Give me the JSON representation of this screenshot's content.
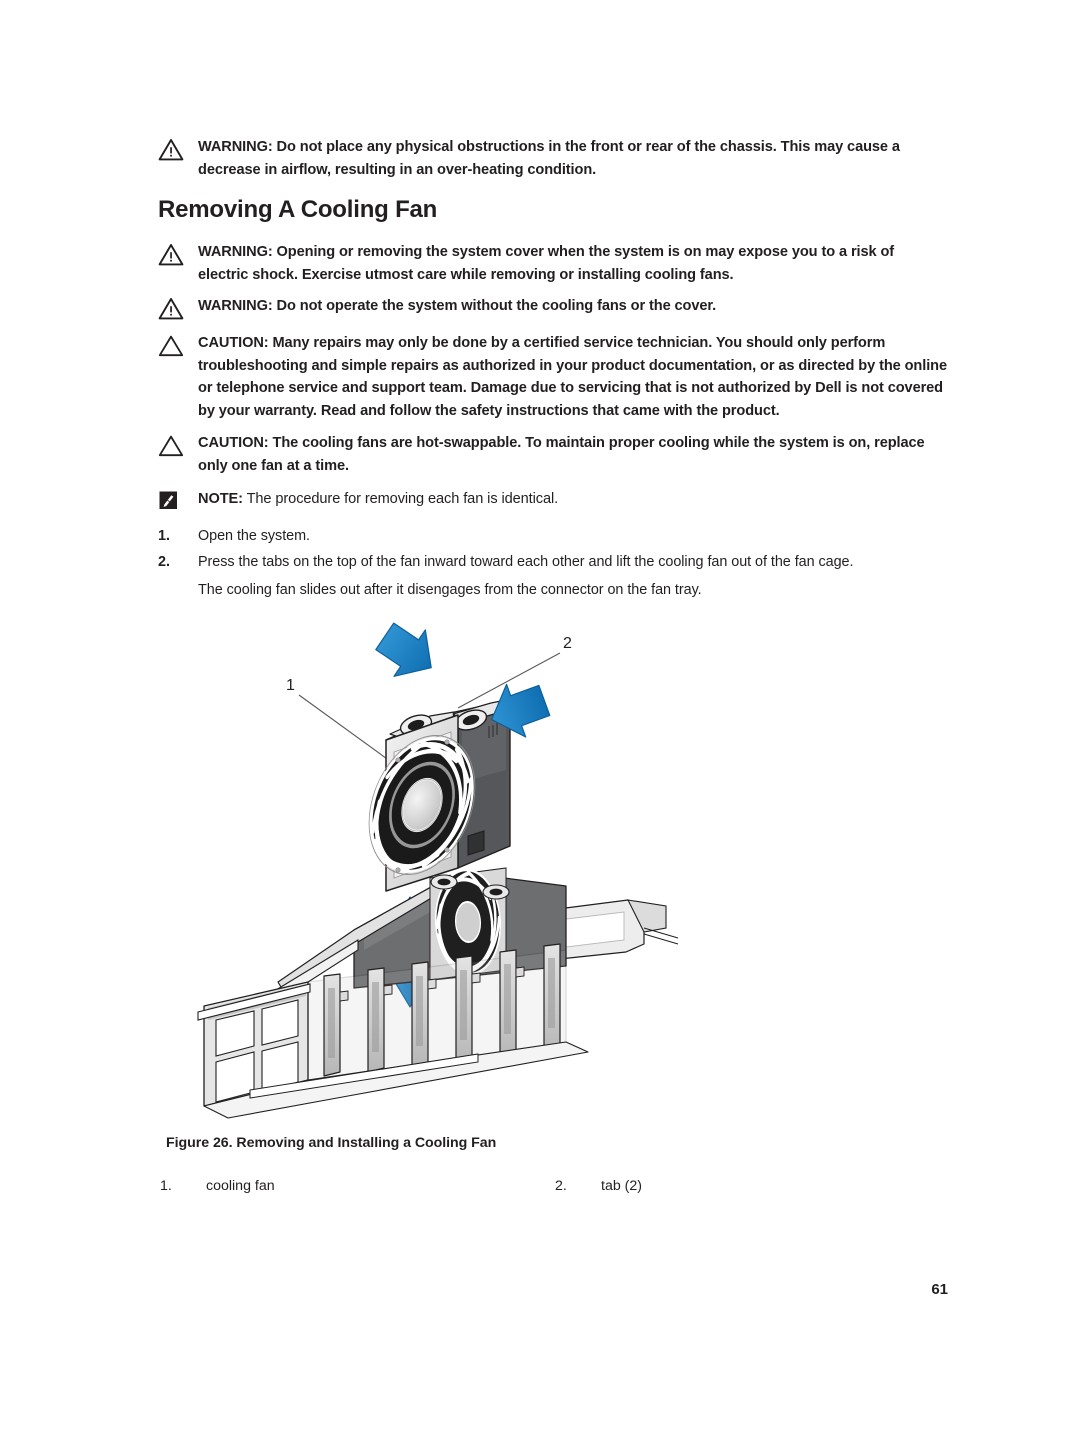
{
  "document": {
    "page_number": "61"
  },
  "admonitions_top": [
    {
      "icon": "warning-triangle-icon",
      "label": "WARNING:",
      "text": " Do not place any physical obstructions in the front or rear of the chassis. This may cause a decrease in airflow, resulting in an over-heating condition."
    }
  ],
  "section": {
    "title": "Removing A Cooling Fan"
  },
  "admonitions": [
    {
      "icon": "warning-triangle-icon",
      "label": "WARNING:",
      "text": " Opening or removing the system cover when the system is on may expose you to a risk of electric shock. Exercise utmost care while removing or installing cooling fans."
    },
    {
      "icon": "warning-triangle-icon",
      "label": "WARNING:",
      "text": " Do not operate the system without the cooling fans or the cover."
    },
    {
      "icon": "caution-triangle-icon",
      "label": "CAUTION:",
      "text": " Many repairs may only be done by a certified service technician. You should only perform troubleshooting and simple repairs as authorized in your product documentation, or as directed by the online or telephone service and support team. Damage due to servicing that is not authorized by Dell is not covered by your warranty. Read and follow the safety instructions that came with the product."
    },
    {
      "icon": "caution-triangle-icon",
      "label": "CAUTION:",
      "text": " The cooling fans are hot-swappable. To maintain proper cooling while the system is on, replace only one fan at a time."
    },
    {
      "icon": "note-pencil-icon",
      "label": "NOTE:",
      "text": " The procedure for removing each fan is identical."
    }
  ],
  "steps": [
    {
      "number": "1.",
      "text": "Open the system.",
      "sub": ""
    },
    {
      "number": "2.",
      "text": "Press the tabs on the top of the fan inward toward each other and lift the cooling fan out of the fan cage.",
      "sub": "The cooling fan slides out after it disengages from the connector on the fan tray."
    }
  ],
  "figure": {
    "caption": "Figure 26. Removing and Installing a Cooling Fan",
    "callouts": [
      {
        "number": "1",
        "label": "cooling fan"
      },
      {
        "number": "2",
        "label": "tab (2)"
      }
    ],
    "legend_numbers": [
      {
        "number": "1.",
        "label": "cooling fan"
      },
      {
        "number": "2.",
        "label": "tab (2)"
      }
    ],
    "colors": {
      "arrow_blue": "#1b7fc4",
      "arrow_blue_dark": "#0e62a0",
      "metal_light": "#e8e8e8",
      "metal_mid": "#bdbdbd",
      "metal_dark": "#6e6e6e",
      "metal_darker": "#4a4a4a",
      "outline": "#231f20"
    }
  }
}
